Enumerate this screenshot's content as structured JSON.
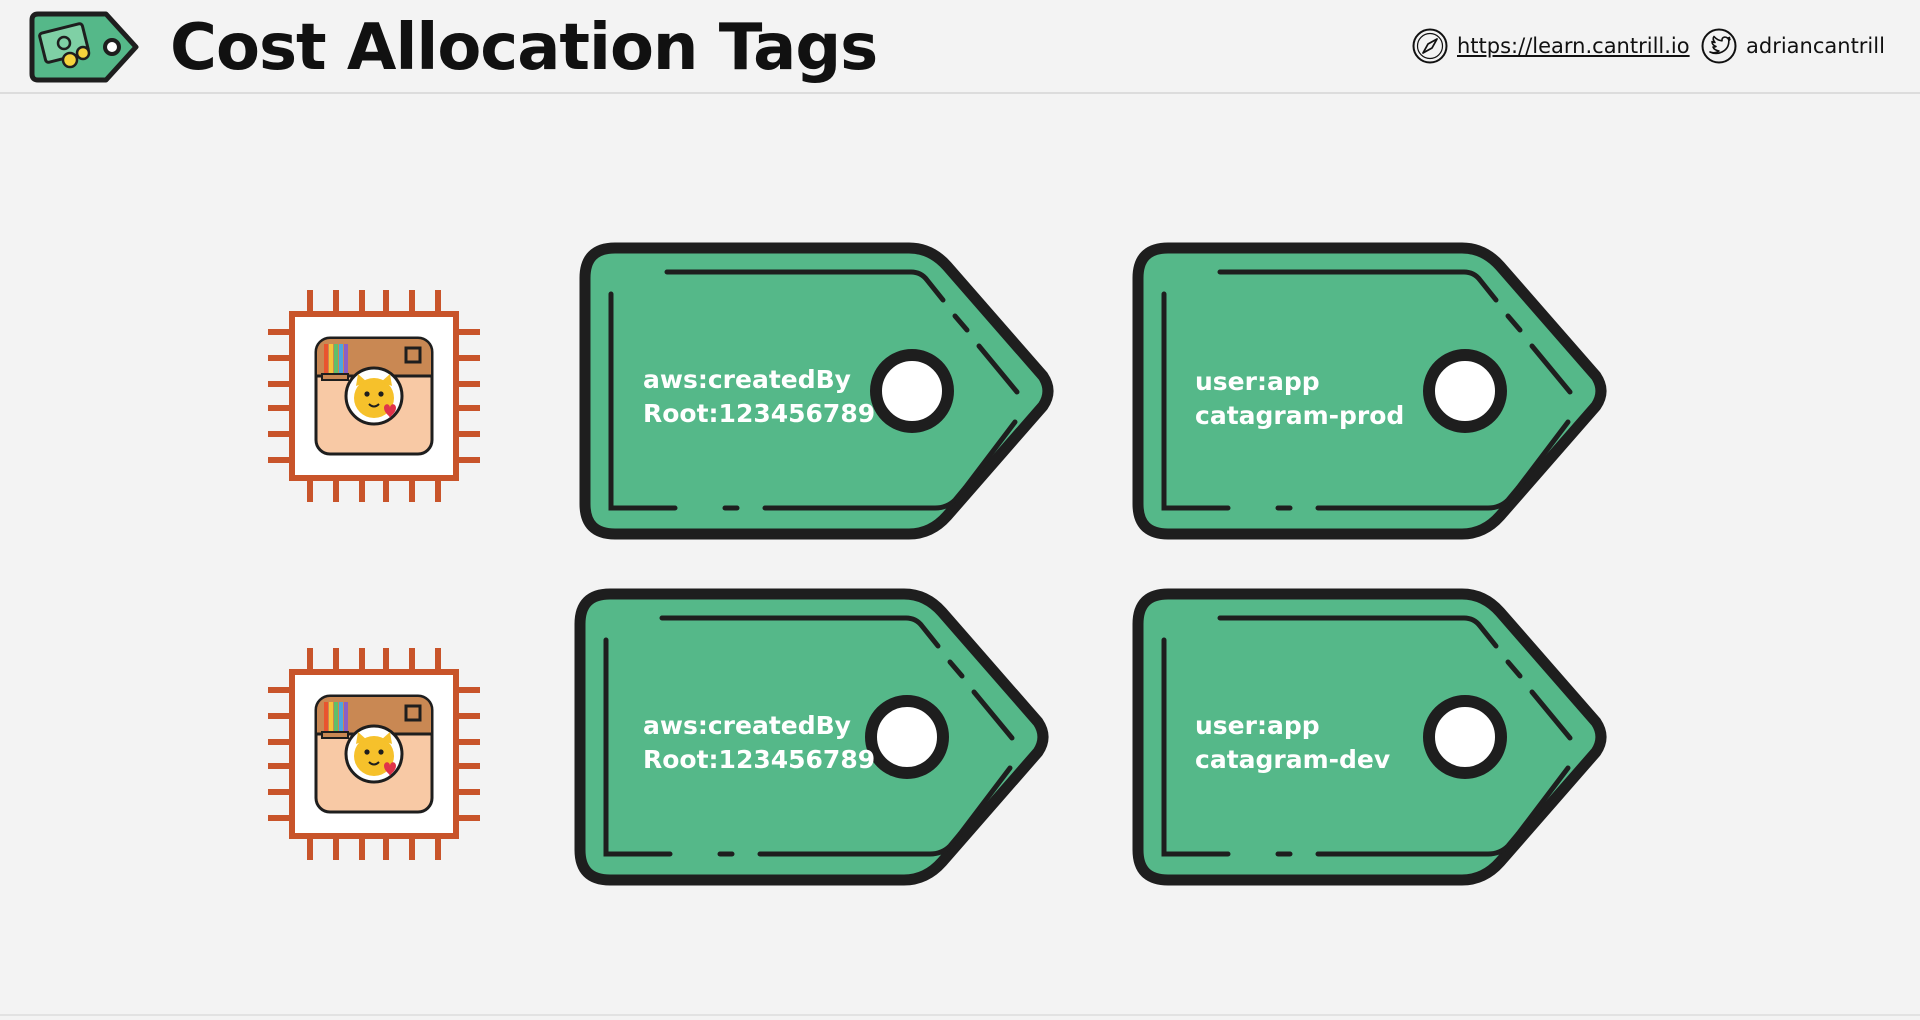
{
  "header": {
    "title": "Cost Allocation Tags",
    "website": "https://learn.cantrill.io",
    "twitter": "adriancantrill",
    "logo_icon": "price-tag-money-icon",
    "website_icon": "compass-icon",
    "twitter_icon": "twitter-bird-icon"
  },
  "colors": {
    "tag_green": "#55b889",
    "tag_outline": "#1e1e1e",
    "instance_orange": "#c8542a",
    "app_icon_tan": "#c98853",
    "app_icon_peach": "#f8c9a5",
    "background": "#f3f3f3"
  },
  "diagram": {
    "rows": [
      {
        "instance_icon": "ec2-instance-catagram-icon",
        "tags": [
          {
            "key": "aws:createdBy",
            "value": "Root:123456789"
          },
          {
            "key": "user:app",
            "value": "catagram-prod"
          }
        ]
      },
      {
        "instance_icon": "ec2-instance-catagram-icon",
        "tags": [
          {
            "key": "aws:createdBy",
            "value": "Root:123456789"
          },
          {
            "key": "user:app",
            "value": "catagram-dev"
          }
        ]
      }
    ]
  }
}
